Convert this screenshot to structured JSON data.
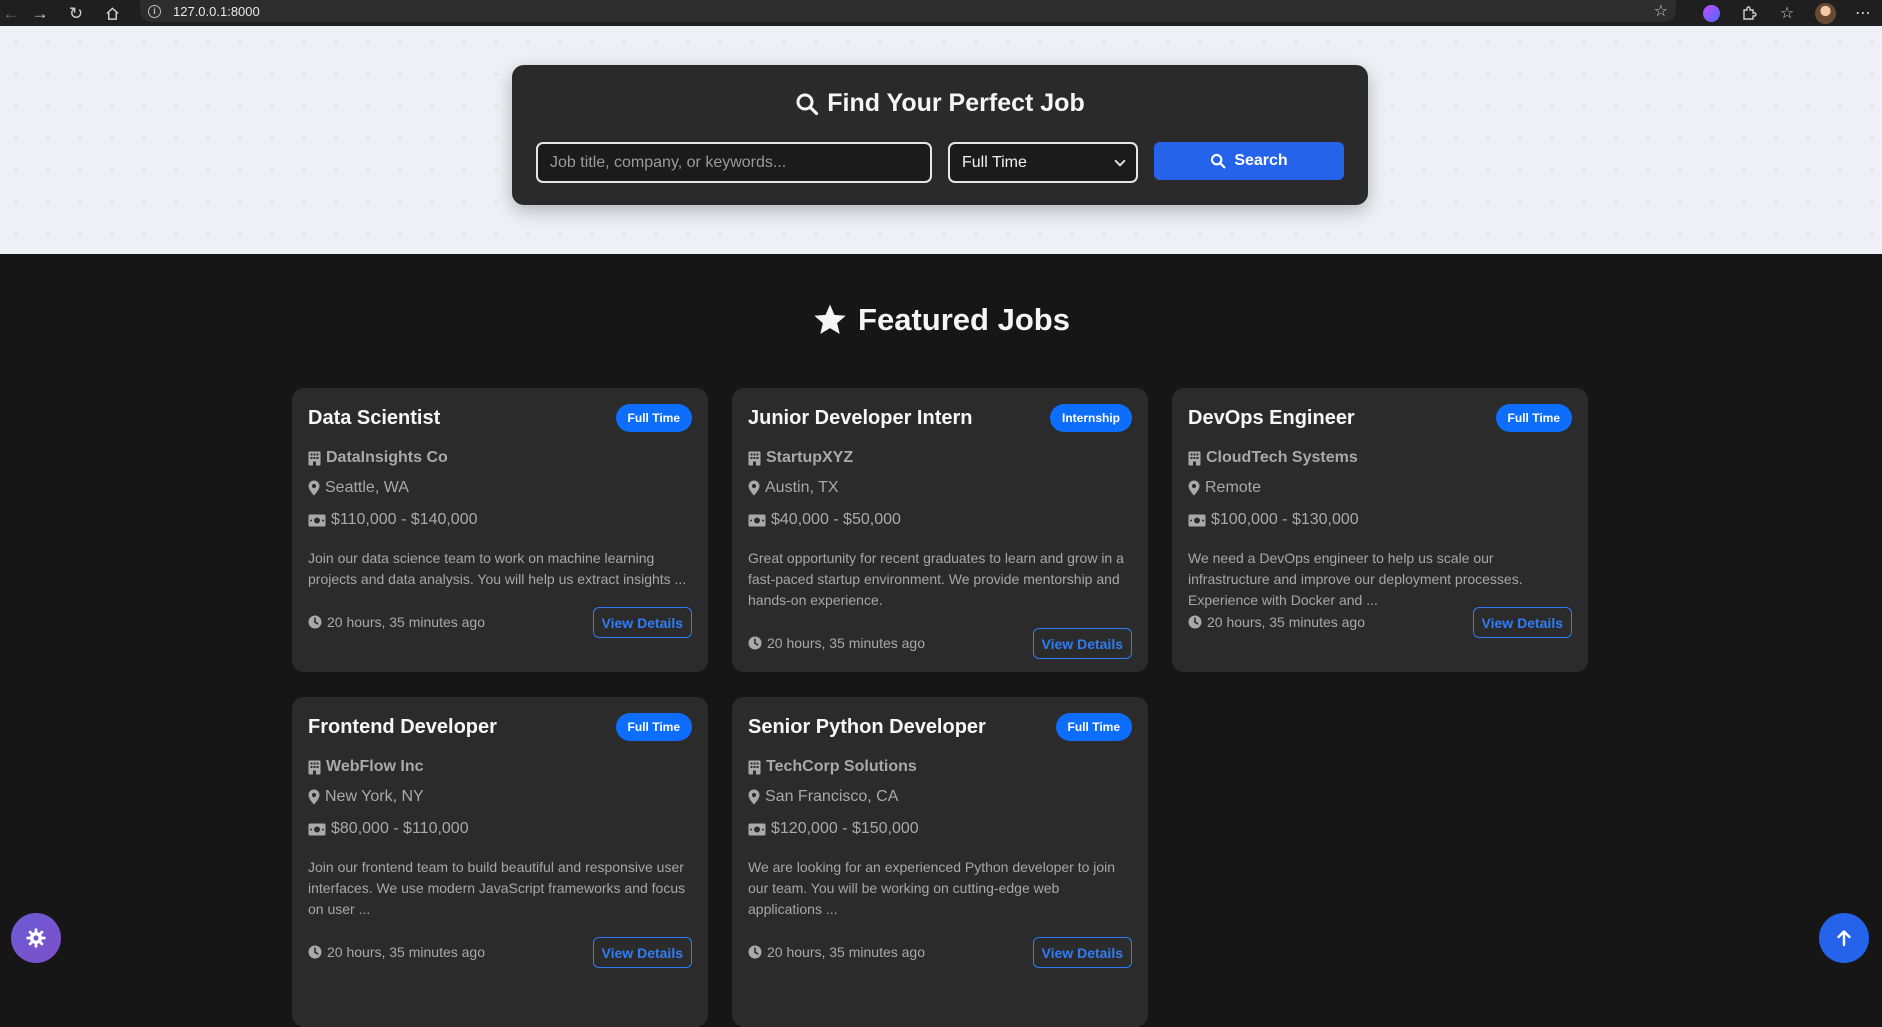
{
  "browser": {
    "url": "127.0.0.1:8000"
  },
  "search": {
    "title": "Find Your Perfect Job",
    "placeholder": "Job title, company, or keywords...",
    "job_type_selected": "Full Time",
    "button_label": "Search"
  },
  "featured": {
    "title": "Featured Jobs"
  },
  "jobs": [
    {
      "title": "Data Scientist",
      "type": "Full Time",
      "company": "DataInsights Co",
      "location": "Seattle, WA",
      "salary": "$110,000 - $140,000",
      "description": "Join our data science team to work on machine learning projects and data analysis. You will help us extract insights ...",
      "posted": "20 hours, 35 minutes ago",
      "button": "View Details"
    },
    {
      "title": "Junior Developer Intern",
      "type": "Internship",
      "company": "StartupXYZ",
      "location": "Austin, TX",
      "salary": "$40,000 - $50,000",
      "description": "Great opportunity for recent graduates to learn and grow in a fast-paced startup environment. We provide mentorship and hands-on experience.",
      "posted": "20 hours, 35 minutes ago",
      "button": "View Details"
    },
    {
      "title": "DevOps Engineer",
      "type": "Full Time",
      "company": "CloudTech Systems",
      "location": "Remote",
      "salary": "$100,000 - $130,000",
      "description": "We need a DevOps engineer to help us scale our infrastructure and improve our deployment processes. Experience with Docker and ...",
      "posted": "20 hours, 35 minutes ago",
      "button": "View Details"
    },
    {
      "title": "Frontend Developer",
      "type": "Full Time",
      "company": "WebFlow Inc",
      "location": "New York, NY",
      "salary": "$80,000 - $110,000",
      "description": "Join our frontend team to build beautiful and responsive user interfaces. We use modern JavaScript frameworks and focus on user ...",
      "posted": "20 hours, 35 minutes ago",
      "button": "View Details"
    },
    {
      "title": "Senior Python Developer",
      "type": "Full Time",
      "company": "TechCorp Solutions",
      "location": "San Francisco, CA",
      "salary": "$120,000 - $150,000",
      "description": "We are looking for an experienced Python developer to join our team. You will be working on cutting-edge web applications ...",
      "posted": "20 hours, 35 minutes ago",
      "button": "View Details"
    }
  ],
  "icons": {
    "search": "magnifier-icon",
    "featured": "star-icon",
    "company": "building-icon",
    "location": "map-pin-icon",
    "salary": "money-bill-icon",
    "posted": "clock-icon",
    "theme": "gear-icon",
    "scroll_top": "arrow-up-icon"
  },
  "colors": {
    "accent": "#2563eb",
    "badge": "#0d6efd",
    "card_bg": "#2b2b2b",
    "page_bg": "#161616"
  }
}
